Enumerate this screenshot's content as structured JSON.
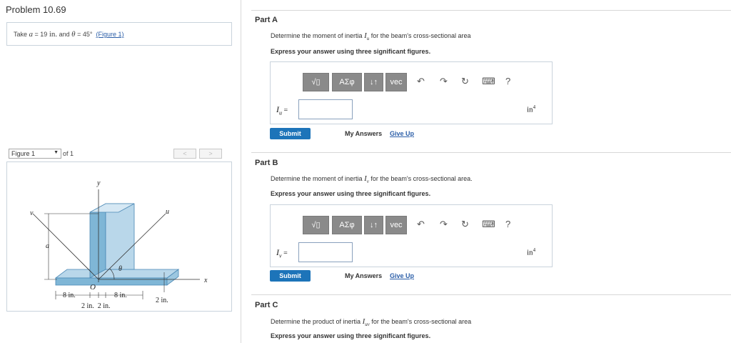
{
  "problem": {
    "title": "Problem 10.69",
    "given_prefix": "Take",
    "a_sym": "a",
    "a_eq": " = 19 ",
    "a_unit": "in.",
    "and": " and ",
    "theta_sym": "θ",
    "theta_eq": " = 45°",
    "figure_link": "(Figure 1)"
  },
  "figure_nav": {
    "selected": "Figure 1",
    "of_label": "of 1",
    "prev": "<",
    "next": ">"
  },
  "figure": {
    "labels": {
      "y": "y",
      "v": "v",
      "u": "u",
      "a": "a",
      "theta": "θ",
      "O": "O",
      "x": "x",
      "dim_left": "8 in.",
      "dim_right": "8 in.",
      "dim_bottom": "2 in.  2 in.",
      "dim_thick": "2 in."
    },
    "colors": {
      "face": "#b9d7ea",
      "side": "#7fb6d6",
      "edge": "#4a88b5"
    }
  },
  "toolbar": {
    "btn1": "√▯",
    "btn2": "ΑΣφ",
    "btn3": "↓↑",
    "btn4": "vec",
    "undo": "↶",
    "redo": "↷",
    "reset": "↻",
    "keyboard": "⌨",
    "help": "?"
  },
  "parts": [
    {
      "title": "Part A",
      "q_pre": "Determine the moment of inertia ",
      "q_sym": "I",
      "q_sub": "u",
      "q_post": " for the beam's cross-sectional area",
      "instruction": "Express your answer using three significant figures.",
      "var": "I",
      "var_sub": "u",
      "eq": " =",
      "input_value": "",
      "unit": "in",
      "unit_exp": "4",
      "submit": "Submit",
      "my_answers": "My Answers",
      "give_up": "Give Up"
    },
    {
      "title": "Part B",
      "q_pre": "Determine the moment of inertia ",
      "q_sym": "I",
      "q_sub": "v",
      "q_post": " for the beam's cross-sectional area.",
      "instruction": "Express your answer using three significant figures.",
      "var": "I",
      "var_sub": "v",
      "eq": " =",
      "input_value": "",
      "unit": "in",
      "unit_exp": "4",
      "submit": "Submit",
      "my_answers": "My Answers",
      "give_up": "Give Up"
    },
    {
      "title": "Part C",
      "q_pre": "Determine the product of inertia ",
      "q_sym": "I",
      "q_sub": "uv",
      "q_post": " for the beam's cross-sectional area",
      "instruction": "Express your answer using three significant figures."
    }
  ]
}
